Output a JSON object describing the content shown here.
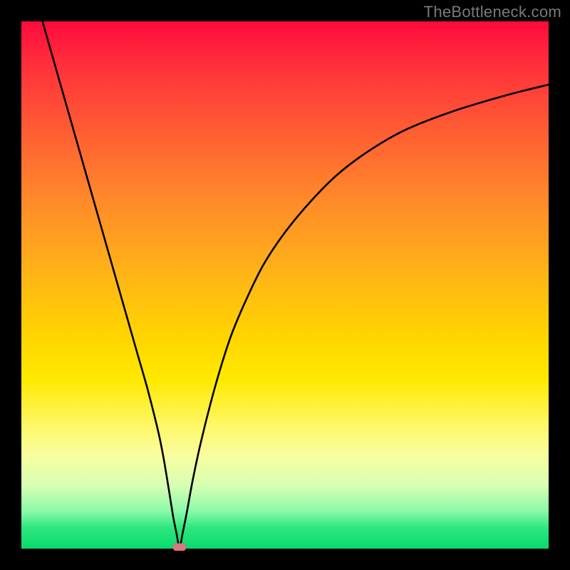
{
  "watermark_text": "TheBottleneck.com",
  "chart_data": {
    "type": "line",
    "title": "",
    "xlabel": "",
    "ylabel": "",
    "xlim": [
      0,
      100
    ],
    "ylim": [
      0,
      100
    ],
    "grid": false,
    "legend": false,
    "background_gradient": {
      "top": "#ff0a3c",
      "bottom": "#08da6c",
      "stops": [
        "red",
        "orange",
        "yellow",
        "green"
      ]
    },
    "series": [
      {
        "name": "bottleneck-curve",
        "color": "#000000",
        "x": [
          4,
          6,
          8,
          10,
          12,
          14,
          16,
          18,
          20,
          22,
          24,
          26,
          27,
          28,
          28.8,
          29.4,
          30,
          30.6,
          31.4,
          32.5,
          34,
          36,
          38,
          40,
          43,
          46,
          50,
          55,
          60,
          66,
          73,
          82,
          92,
          100
        ],
        "y": [
          100,
          93,
          86,
          79,
          72,
          65,
          58,
          51,
          44,
          37,
          30,
          22,
          17,
          11,
          6,
          3,
          0.3,
          3,
          7,
          13,
          20,
          28,
          35,
          41,
          48,
          54,
          60,
          66,
          71,
          75.5,
          79.5,
          83,
          86,
          88
        ]
      }
    ],
    "marker": {
      "name": "minimum-point",
      "x": 30,
      "y": 0.3,
      "color": "#d97a80",
      "shape": "rounded-rect"
    }
  }
}
